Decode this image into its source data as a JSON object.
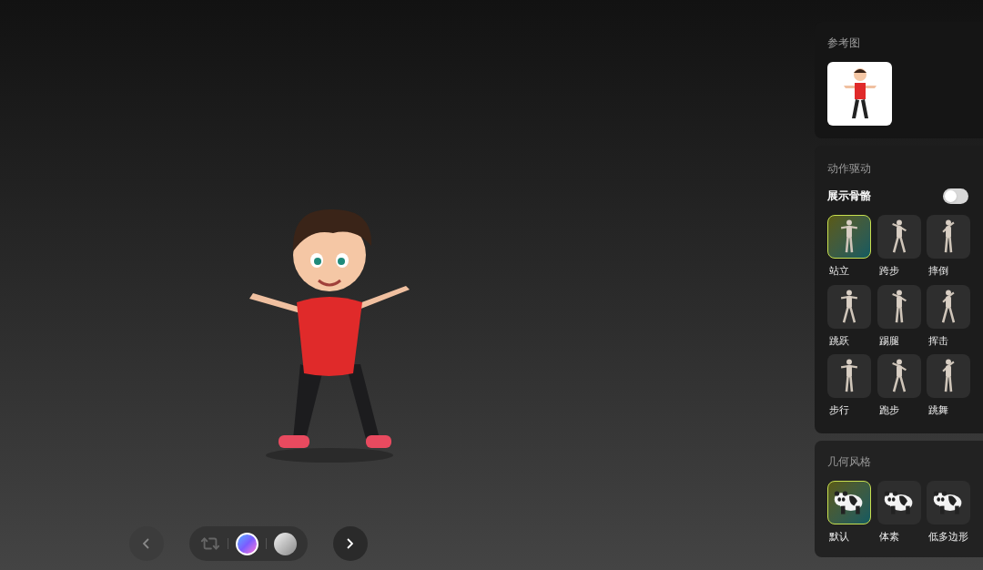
{
  "reference": {
    "title": "参考图"
  },
  "motion": {
    "title": "动作驱动",
    "skeleton": {
      "label": "展示骨骼",
      "on": false
    },
    "items": [
      {
        "label": "站立",
        "selected": true
      },
      {
        "label": "跨步",
        "selected": false
      },
      {
        "label": "摔倒",
        "selected": false
      },
      {
        "label": "跳跃",
        "selected": false
      },
      {
        "label": "踢腿",
        "selected": false
      },
      {
        "label": "挥击",
        "selected": false
      },
      {
        "label": "步行",
        "selected": false
      },
      {
        "label": "跑步",
        "selected": false
      },
      {
        "label": "跳舞",
        "selected": false
      }
    ]
  },
  "geometry": {
    "title": "几何风格",
    "items": [
      {
        "label": "默认",
        "selected": true
      },
      {
        "label": "体素",
        "selected": false
      },
      {
        "label": "低多边形",
        "selected": false
      }
    ]
  },
  "viewer": {
    "prev": {
      "disabled": true
    },
    "next": {
      "disabled": false
    },
    "materials": [
      {
        "kind": "gradient",
        "selected": true
      },
      {
        "kind": "clay",
        "selected": false
      }
    ]
  }
}
